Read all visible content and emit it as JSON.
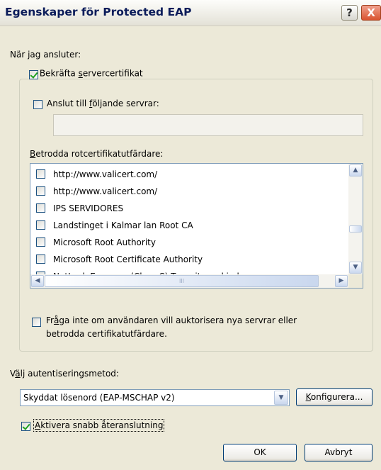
{
  "window": {
    "title": "Egenskaper för Protected EAP",
    "help_glyph": "?",
    "close_glyph": "X"
  },
  "connect": {
    "label": "När jag ansluter:",
    "verify_cert": {
      "label_pre": "Bekräfta ",
      "label_key": "s",
      "label_post": "ervercertifikat",
      "checked": true
    },
    "connect_servers": {
      "label_pre": "Anslut till ",
      "label_key": "f",
      "label_post": "öljande servrar:",
      "checked": false,
      "value": ""
    }
  },
  "trusted_ca": {
    "label_key": "B",
    "label_rest": "etrodda rotcertifikatutfärdare:",
    "items": [
      {
        "label": "http://www.valicert.com/",
        "checked": false
      },
      {
        "label": "http://www.valicert.com/",
        "checked": false
      },
      {
        "label": "IPS SERVIDORES",
        "checked": false
      },
      {
        "label": "Landstinget i Kalmar lan Root CA",
        "checked": false
      },
      {
        "label": "Microsoft Root Authority",
        "checked": false
      },
      {
        "label": "Microsoft Root Certificate Authority",
        "checked": false
      },
      {
        "label": "NetLock Expressz (Class C) Tanusitvanykiado",
        "checked": false
      }
    ],
    "scroll_up": "▲",
    "scroll_down": "▼",
    "scroll_left": "◀",
    "scroll_right": "▶",
    "grip": "III"
  },
  "prompt_option": {
    "line1_pre": "Fr",
    "line1_key": "å",
    "line1_post": "ga inte om användaren vill auktorisera nya servrar eller",
    "line2": "betrodda certifikatutfärdare.",
    "checked": false
  },
  "auth": {
    "label_pre": "V",
    "label_key": "ä",
    "label_post": "lj autentiseringsmetod:",
    "selected": "Skyddat lösenord (EAP-MSCHAP v2)",
    "dropdown_glyph": "▼",
    "configure_key": "K",
    "configure_rest": "onfigurera..."
  },
  "fast_reconnect": {
    "label_key": "A",
    "label_rest": "ktivera snabb återanslutning",
    "checked": true
  },
  "buttons": {
    "ok": "OK",
    "cancel": "Avbryt"
  },
  "colors": {
    "dialog_bg": "#ece9d8",
    "title_text": "#0b1c5a",
    "button_border": "#003c74",
    "check_mark": "#21a121"
  }
}
